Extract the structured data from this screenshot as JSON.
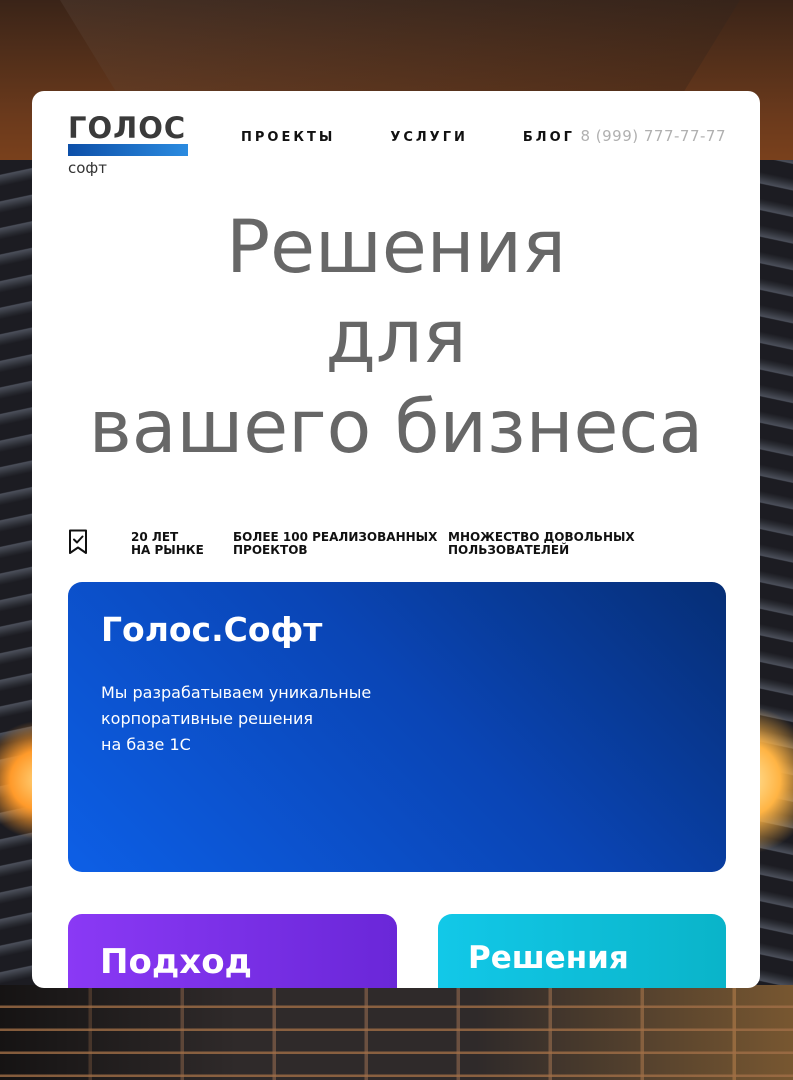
{
  "brand": {
    "name": "ГОЛОС",
    "sub": "софт",
    "bar_colors": [
      "#0d4fa8",
      "#2b8be0"
    ]
  },
  "nav": {
    "items": [
      {
        "label": "ПРОЕКТЫ"
      },
      {
        "label": "УСЛУГИ"
      },
      {
        "label": "БЛОГ"
      }
    ],
    "phone": "8 (999) 777-77-77"
  },
  "hero": {
    "line1": "Решения",
    "line2": "для",
    "line3": "вашего бизнеса"
  },
  "features": {
    "icon": "bookmark-check-icon",
    "items": [
      {
        "line1": "20 ЛЕТ",
        "line2": "НА РЫНКЕ"
      },
      {
        "line1": "БОЛЕЕ 100 РЕАЛИЗОВАННЫХ",
        "line2": "ПРОЕКТОВ"
      },
      {
        "line1": "МНОЖЕСТВО ДОВОЛЬНЫХ",
        "line2": "ПОЛЬЗОВАТЕЛЕЙ"
      }
    ]
  },
  "promo": {
    "title": "Голос.Софт",
    "text_lines": [
      "Мы разрабатываем уникальные",
      "корпоративные решения",
      "на базе 1С"
    ],
    "colors": [
      "#062e75",
      "#0d5fe6"
    ]
  },
  "tiles": [
    {
      "title": "Подход",
      "color": "#7b30e8"
    },
    {
      "title": "Решения",
      "color": "#0fbfd9"
    }
  ]
}
